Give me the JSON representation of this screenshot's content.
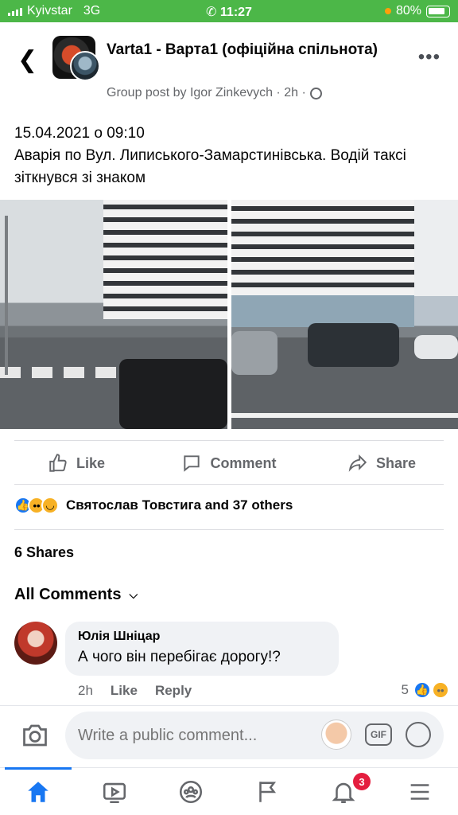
{
  "status_bar": {
    "carrier": "Kyivstar",
    "network": "3G",
    "time": "11:27",
    "battery": "80%"
  },
  "post": {
    "group_name": "Varta1 - Варта1 (офіційна спільнота)",
    "author_line": "Group post by Igor Zinkevych · 2h ·",
    "text_line1": "15.04.2021 о 09:10",
    "text_line2": "Аварія по Вул. Липиського-Замарстинівська. Водій таксі зіткнувся зі знаком"
  },
  "actions": {
    "like": "Like",
    "comment": "Comment",
    "share": "Share"
  },
  "reactions": {
    "summary": "Святослав Товстига and 37 others",
    "icons": [
      "like-icon",
      "wow-icon",
      "haha-icon"
    ]
  },
  "shares": "6 Shares",
  "comments": {
    "header": "All Comments",
    "items": [
      {
        "author": "Юлія Шніцар",
        "text": "А чого він перебігає дорогу!?",
        "time": "2h",
        "like_label": "Like",
        "reply_label": "Reply",
        "reaction_count": "5"
      }
    ]
  },
  "composer": {
    "placeholder": "Write a public comment...",
    "gif_label": "GIF"
  },
  "tabbar": {
    "tabs": [
      "home-icon",
      "watch-icon",
      "groups-icon",
      "pages-icon",
      "notifications-icon",
      "menu-icon"
    ],
    "notification_count": "3"
  },
  "colors": {
    "status_bar": "#4cb748",
    "accent": "#1877f2",
    "badge": "#e41e3f"
  }
}
